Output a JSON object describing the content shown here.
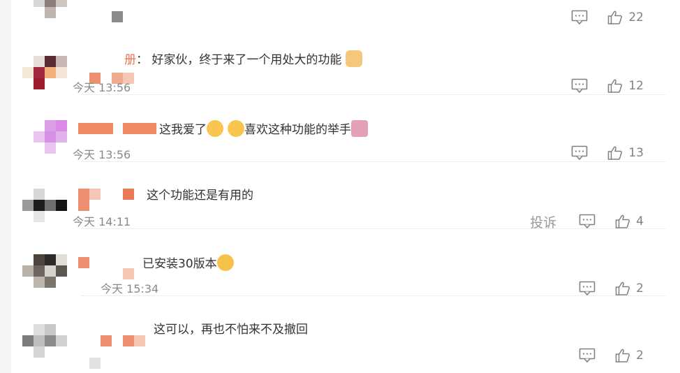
{
  "comments": [
    {
      "name": "",
      "text": "",
      "time": "",
      "reply_count": "",
      "like_count": "22",
      "report": ""
    },
    {
      "name": "册",
      "text": "： 好家伙，终于来了一个用处大的功能",
      "time": "今天 13:56",
      "like_count": "12",
      "report": ""
    },
    {
      "name": "",
      "text": "这我爱了",
      "text2": "喜欢这种功能的举手",
      "time": "今天 13:56",
      "like_count": "13",
      "report": ""
    },
    {
      "name": "",
      "text": "这个功能还是有用的",
      "time": "今天 14:11",
      "like_count": "4",
      "report": "投诉"
    },
    {
      "name": "",
      "text": "已安装30版本",
      "time": "今天 15:34",
      "like_count": "2",
      "report": ""
    },
    {
      "name": "",
      "text": "这可以，再也不怕来不及撤回",
      "time": "",
      "like_count": "2",
      "report": ""
    }
  ],
  "colors": {
    "name_link": "#eb7350",
    "muted": "#808080",
    "text": "#333333"
  }
}
